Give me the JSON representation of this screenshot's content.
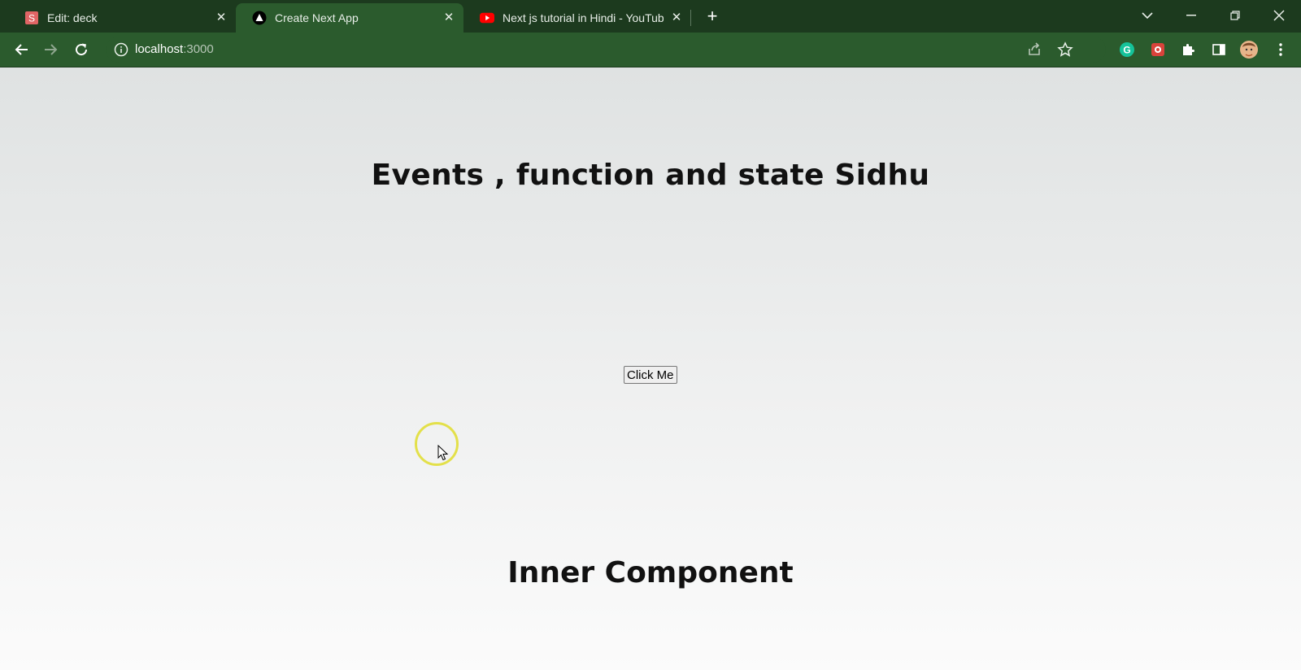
{
  "browser": {
    "tabs": [
      {
        "title": "Edit: deck",
        "favicon": "slides-s-icon",
        "active": false
      },
      {
        "title": "Create Next App",
        "favicon": "nextjs-triangle-icon",
        "active": true
      },
      {
        "title": "Next js tutorial in Hindi - YouTube",
        "favicon": "youtube-icon",
        "active": false
      }
    ],
    "address": {
      "host": "localhost",
      "port": ":3000"
    },
    "accent": "#2b5b2d",
    "tabbar_color": "#1c3a1e"
  },
  "page": {
    "heading": "Events , function and state Sidhu",
    "button_label": "Click Me",
    "subheading": "Inner Component"
  }
}
